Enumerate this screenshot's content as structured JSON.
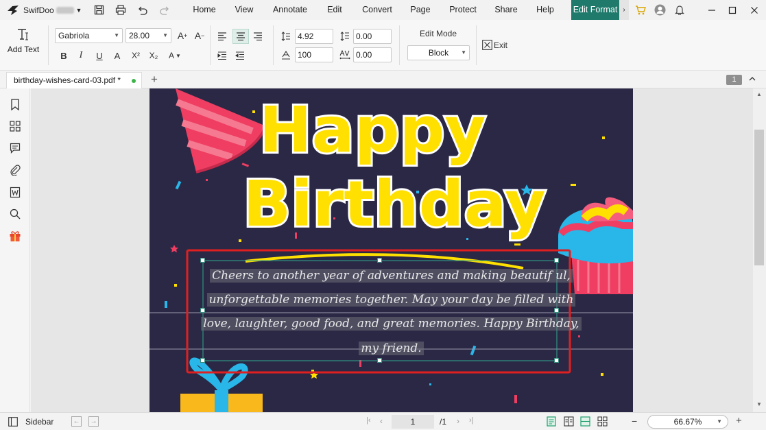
{
  "app": {
    "name": "SwifDoo"
  },
  "menu": {
    "items": [
      "Home",
      "View",
      "Annotate",
      "Edit",
      "Convert",
      "Page",
      "Protect",
      "Share",
      "Help"
    ],
    "active": "Edit Format"
  },
  "ribbon": {
    "add_text_label": "Add Text",
    "font_name": "Gabriola",
    "font_size": "28.00",
    "line_spacing": "4.92",
    "char_spacing": "0.00",
    "scale": "100",
    "baseline": "0.00",
    "edit_mode_label": "Edit Mode",
    "edit_mode_value": "Block",
    "exit_label": "Exit",
    "bold": "B",
    "italic": "I",
    "underline": "U",
    "grow": "A",
    "sup": "X²",
    "sub": "X₂"
  },
  "tabs": {
    "doc_name": "birthday-wishes-card-03.pdf *",
    "add": "+",
    "page_badge": "1"
  },
  "page": {
    "heading1": "Happy",
    "heading2": "Birthday",
    "paragraph_lines": [
      "Cheers to another year of adventures and making beautif ul,",
      "unforgettable memories together. May your day be filled with",
      "love, laughter, good food, and great memories. Happy Birthday,",
      "my friend."
    ]
  },
  "status": {
    "sidebar_label": "Sidebar",
    "current_page": "1",
    "total_pages": "/1",
    "zoom": "66.67%",
    "minus": "−",
    "plus": "+"
  },
  "colors": {
    "accent": "#1f7a6b",
    "page_bg": "#2b2845",
    "title_yellow": "#ffe000",
    "selection_red": "#e02020"
  }
}
